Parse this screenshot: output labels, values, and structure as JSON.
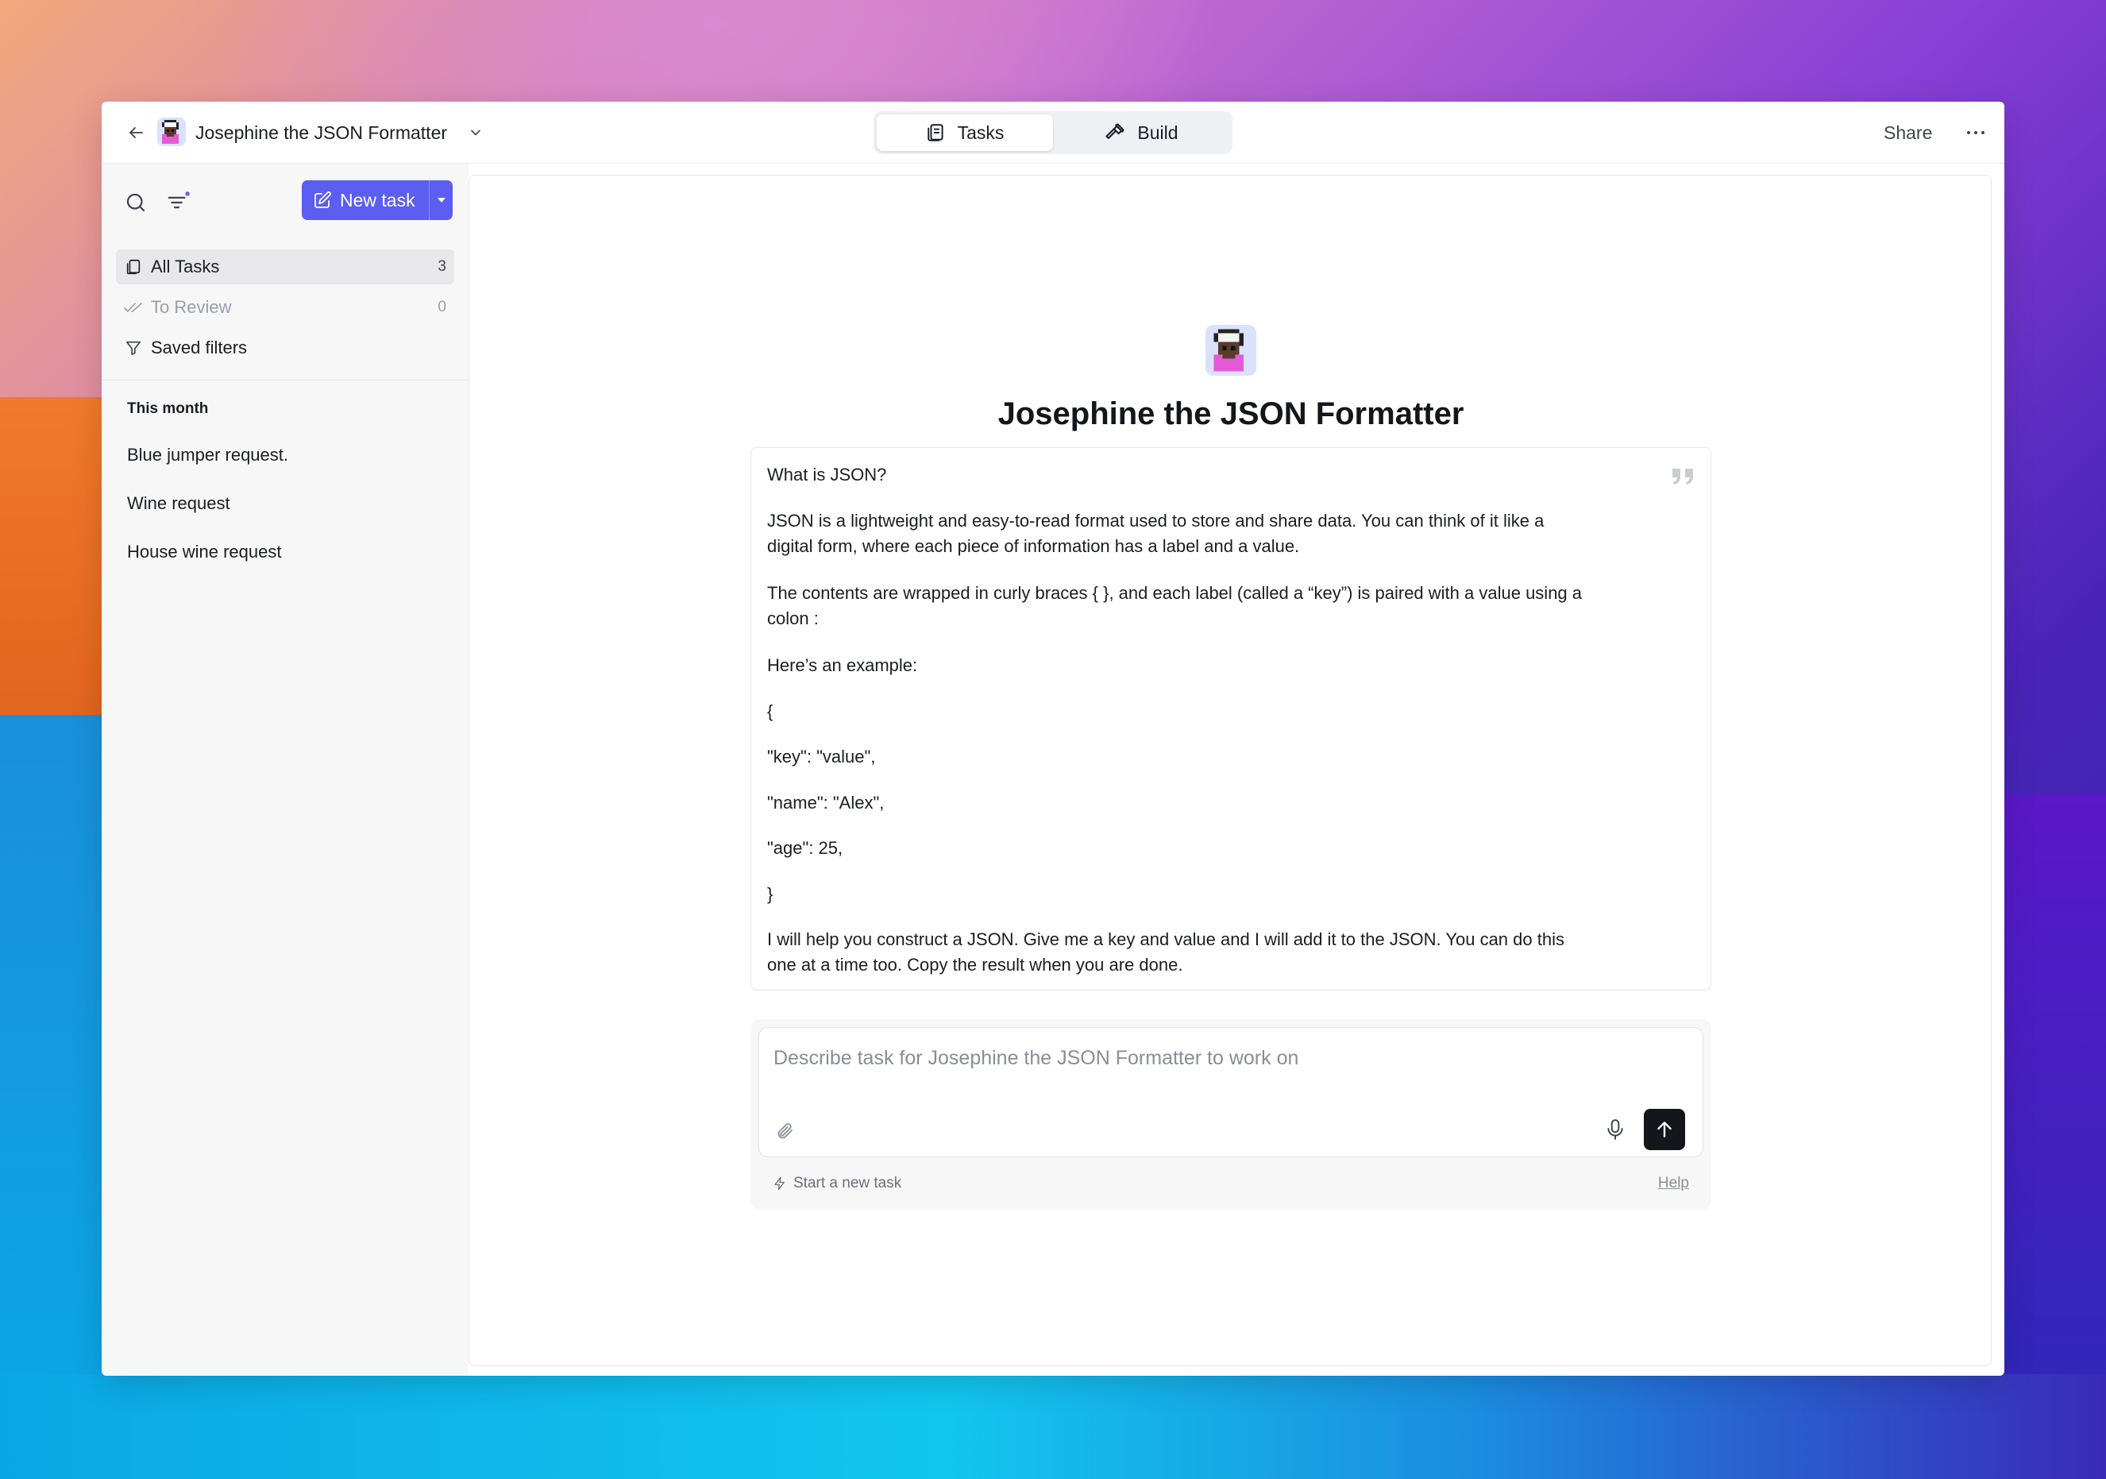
{
  "header": {
    "agent_name": "Josephine the JSON Formatter",
    "tabs": [
      {
        "label": "Tasks",
        "active": true,
        "icon": "tasks-icon"
      },
      {
        "label": "Build",
        "active": false,
        "icon": "hammer-icon"
      }
    ],
    "share_label": "Share"
  },
  "sidebar": {
    "new_task_label": "New task",
    "nav": [
      {
        "label": "All Tasks",
        "count": "3",
        "icon": "copy-icon"
      },
      {
        "label": "To Review",
        "count": "0",
        "icon": "double-check-icon"
      },
      {
        "label": "Saved filters",
        "count": "",
        "icon": "funnel-icon"
      }
    ],
    "section_title": "This month",
    "tasks": [
      "Blue jumper request.",
      "Wine request",
      "House wine request"
    ]
  },
  "main": {
    "title": "Josephine the JSON Formatter",
    "prompt_lines": [
      "What is JSON?",
      "JSON is a lightweight and easy-to-read format used to store and share data. You can think of it like a digital form, where each piece of information has a label and a value.",
      "The contents are wrapped in curly braces { }, and each label (called a “key”) is paired with a value using a colon :",
      "Here’s an example:",
      "{",
      "\"key\": \"value\",",
      "\"name\": \"Alex\",",
      "\"age\": 25,",
      "}",
      "I will help you construct a JSON. Give me a key and value and I will add it to the JSON. You can do this one at a time too. Copy the result when you are done."
    ],
    "composer": {
      "placeholder": "Describe task for Josephine the JSON Formatter to work on",
      "start_new_label": "Start a new task",
      "help_label": "Help"
    }
  },
  "colors": {
    "accent": "#5b5ef0",
    "send_button": "#14161c"
  }
}
